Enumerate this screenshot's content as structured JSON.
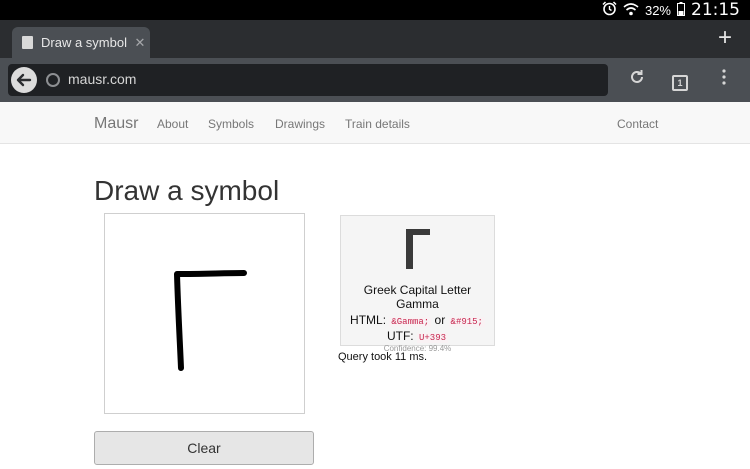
{
  "status_bar": {
    "battery": "32%",
    "time": "21:15"
  },
  "browser": {
    "tab_title": "Draw a symbol",
    "tab_close": "✕",
    "new_tab": "+",
    "url": "mausr.com",
    "tab_count": "1"
  },
  "nav": {
    "brand": "Mausr",
    "links": [
      "About",
      "Symbols",
      "Drawings",
      "Train details"
    ],
    "contact": "Contact"
  },
  "main": {
    "title": "Draw a symbol",
    "clear_label": "Clear",
    "query_text": "Query took 11 ms."
  },
  "result": {
    "glyph": "Γ",
    "name": "Greek Capital Letter Gamma",
    "html_prefix": "HTML:",
    "html_entity": "&Gamma;",
    "html_or": "or",
    "html_numeric": "&#915;",
    "utf_prefix": "UTF:",
    "utf_code": "U+393",
    "confidence": "Confidence: 99.4%"
  },
  "colors": {
    "code_pink": "#c7254e",
    "chrome_dark": "#2b2d30",
    "toolbar": "#4b4f54"
  },
  "icons": [
    "alarm-icon",
    "wifi-icon",
    "battery-icon",
    "favicon-icon",
    "back-arrow-icon",
    "globe-icon",
    "reload-icon",
    "tabs-icon",
    "menu-icon"
  ]
}
